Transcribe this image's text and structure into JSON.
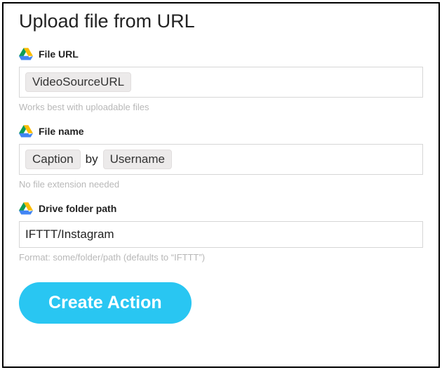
{
  "title": "Upload file from URL",
  "fields": {
    "file_url": {
      "label": "File URL",
      "ingredients": [
        "VideoSourceURL"
      ],
      "hint": "Works best with uploadable files"
    },
    "file_name": {
      "label": "File name",
      "ingredients": [
        "Caption",
        "Username"
      ],
      "separator": "by",
      "hint": "No file extension needed"
    },
    "folder_path": {
      "label": "Drive folder path",
      "value": "IFTTT/Instagram",
      "hint": "Format: some/folder/path (defaults to “IFTTT”)"
    }
  },
  "action_button": "Create Action",
  "icons": {
    "drive": "drive-icon"
  }
}
